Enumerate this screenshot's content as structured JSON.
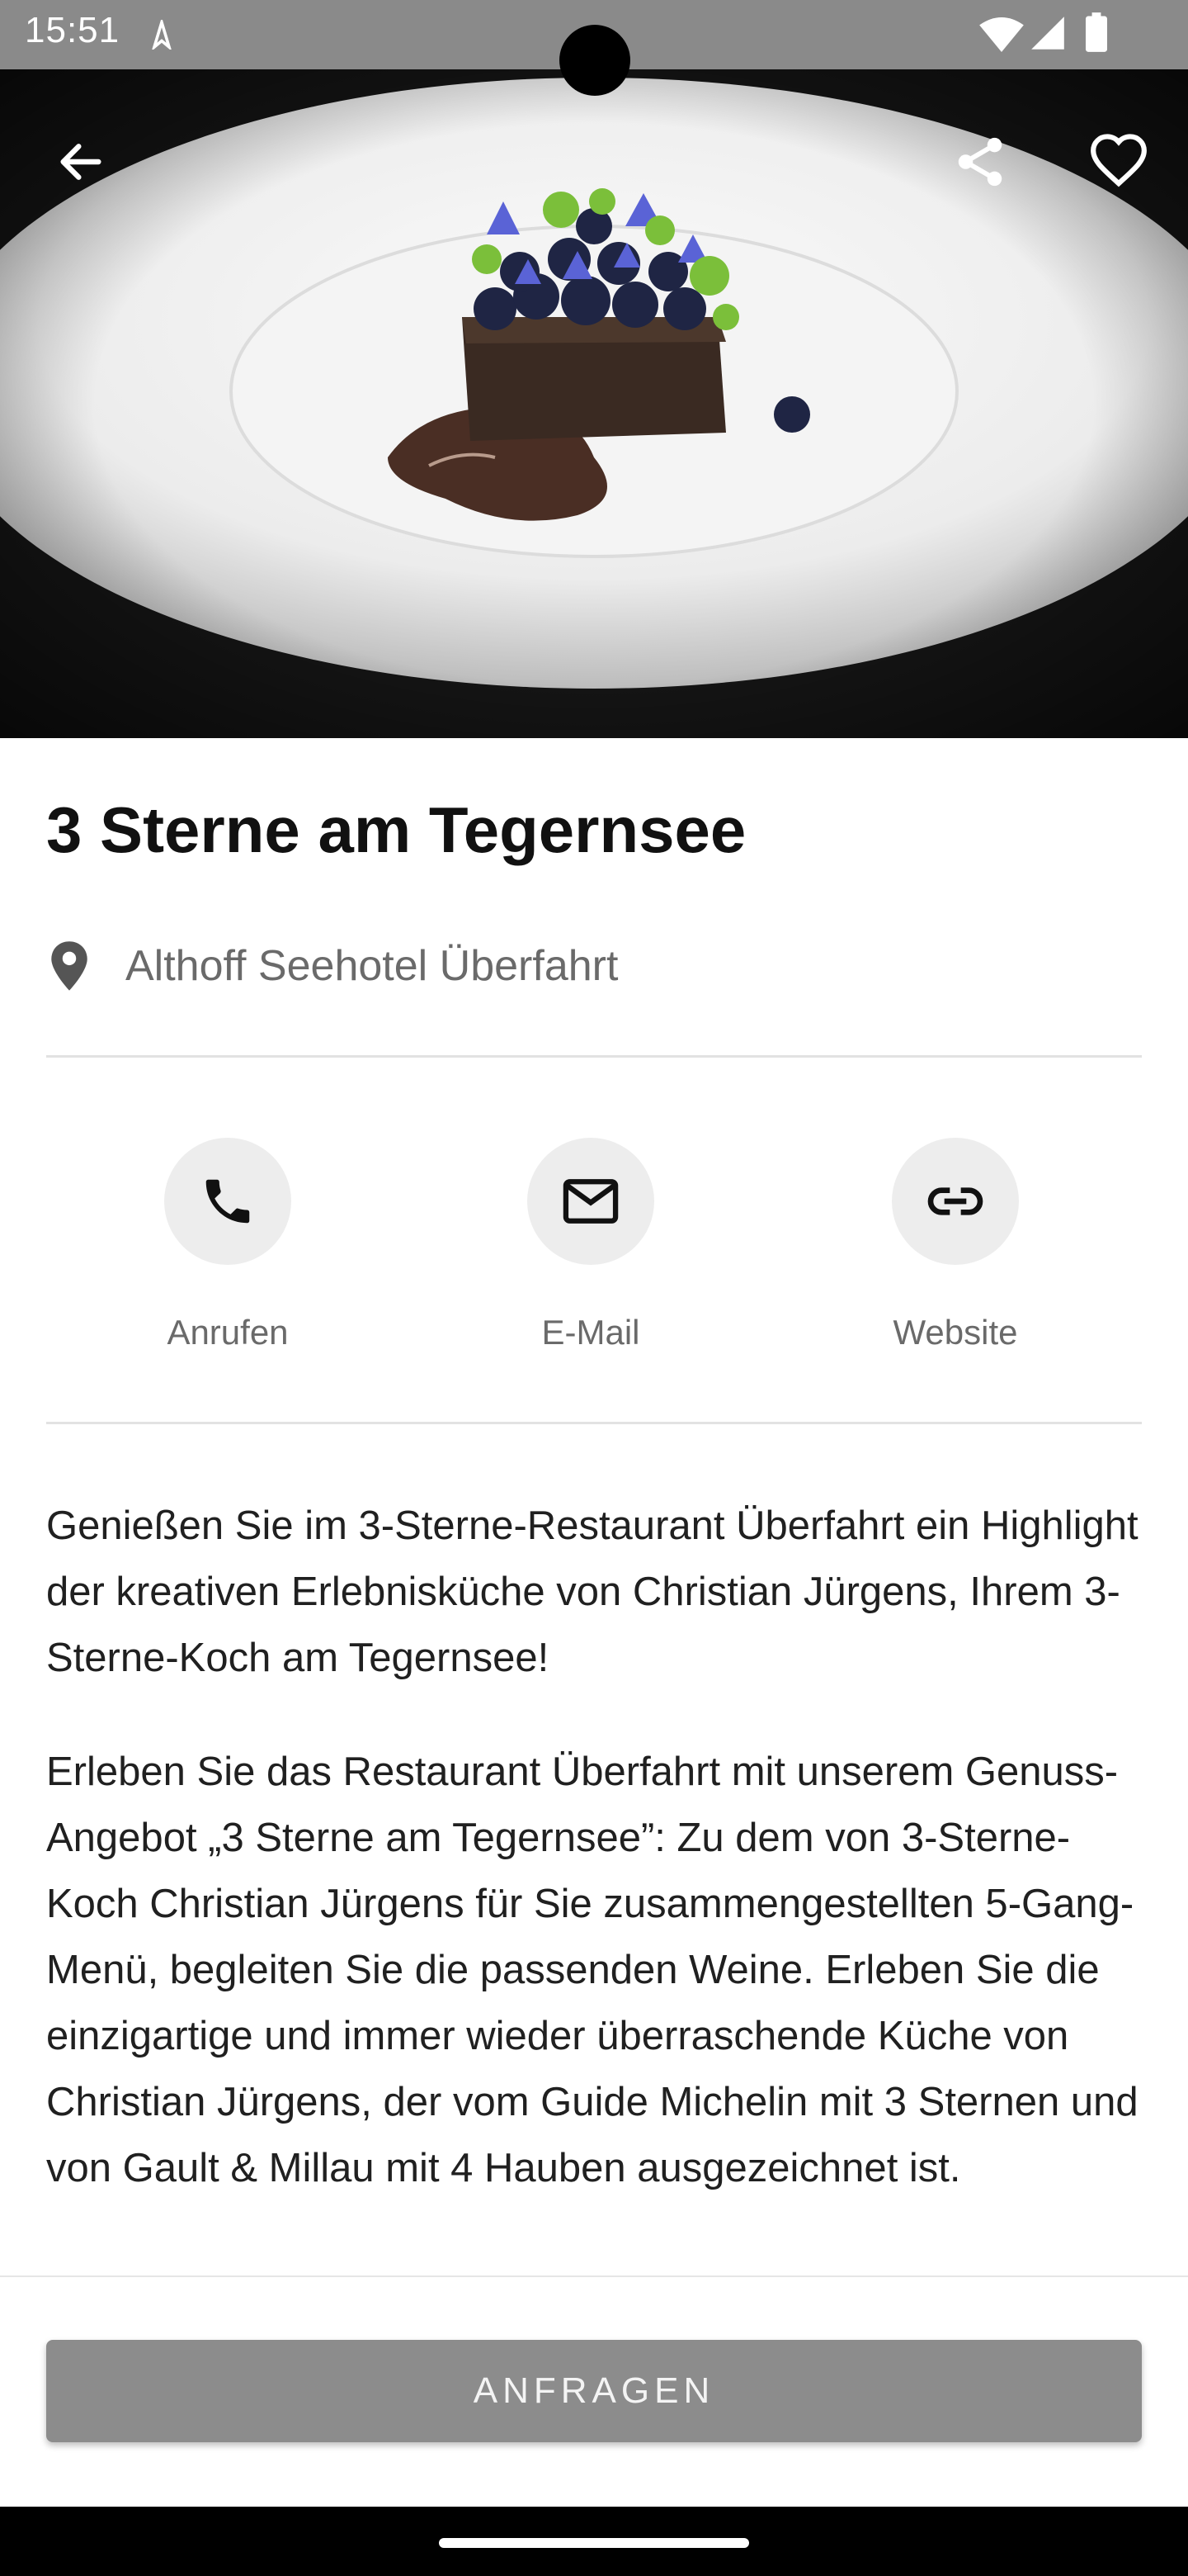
{
  "status_bar": {
    "time": "15:51",
    "icons": [
      "navigation-icon",
      "wifi-icon",
      "signal-icon",
      "battery-icon"
    ]
  },
  "hero": {
    "image_subject": "Gourmet-Dessert mit Blaubeeren und Blüten auf weißem Teller",
    "buttons": [
      "back-arrow-icon",
      "share-icon",
      "heart-icon"
    ]
  },
  "title": "3 Sterne am Tegernsee",
  "location": {
    "icon": "location-pin-icon",
    "label": "Althoff Seehotel Überfahrt"
  },
  "actions": [
    {
      "label": "Anrufen",
      "icon": "phone-icon"
    },
    {
      "label": "E-Mail",
      "icon": "mail-icon"
    },
    {
      "label": "Website",
      "icon": "link-icon"
    }
  ],
  "description": [
    "Genießen Sie im 3-Sterne-Restaurant Überfahrt ein Highlight der kreativen Erlebnisküche von Christian Jürgens, Ihrem 3-Sterne-Koch am Tegernsee!",
    "Erleben Sie das Restaurant Überfahrt mit unserem Genuss-Angebot „3 Sterne am Tegernsee”: Zu dem von 3-Sterne-Koch Christian Jürgens für Sie zusammengestellten 5-Gang-Menü, begleiten Sie die passenden Weine. Erleben Sie die einzigartige und immer wieder überraschende Küche von Christian Jürgens, der vom Guide Michelin mit 3 Sternen und von Gault & Millau mit 4 Hauben ausgezeichnet ist."
  ],
  "cta": {
    "label": "ANFRAGEN"
  },
  "colors": {
    "status_bar": "#8a8a8a",
    "button": "#8c8c8c",
    "circle_bg": "#ededed",
    "muted_text": "#6a6a6a"
  }
}
